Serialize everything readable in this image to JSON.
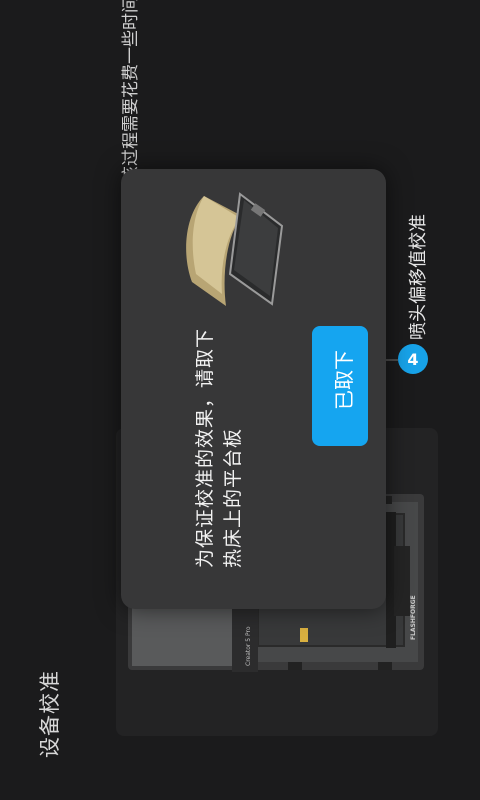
{
  "page": {
    "title": "设备校准"
  },
  "hint": {
    "text": "将会进行以上校准操作，该过程需要花费一些时间"
  },
  "steps": [
    {
      "number": "4",
      "label": "喷头偏移值校准"
    }
  ],
  "printer": {
    "brand": "FLASHFORGE",
    "model": "Creator 5 Pro"
  },
  "modal": {
    "message_line1": "为保证校准的效果，请取下",
    "message_line2": "热床上的平台板",
    "confirm_label": "已取下"
  },
  "colors": {
    "accent": "#15a5f0",
    "background": "#1b1b1c",
    "modal": "#373738"
  }
}
